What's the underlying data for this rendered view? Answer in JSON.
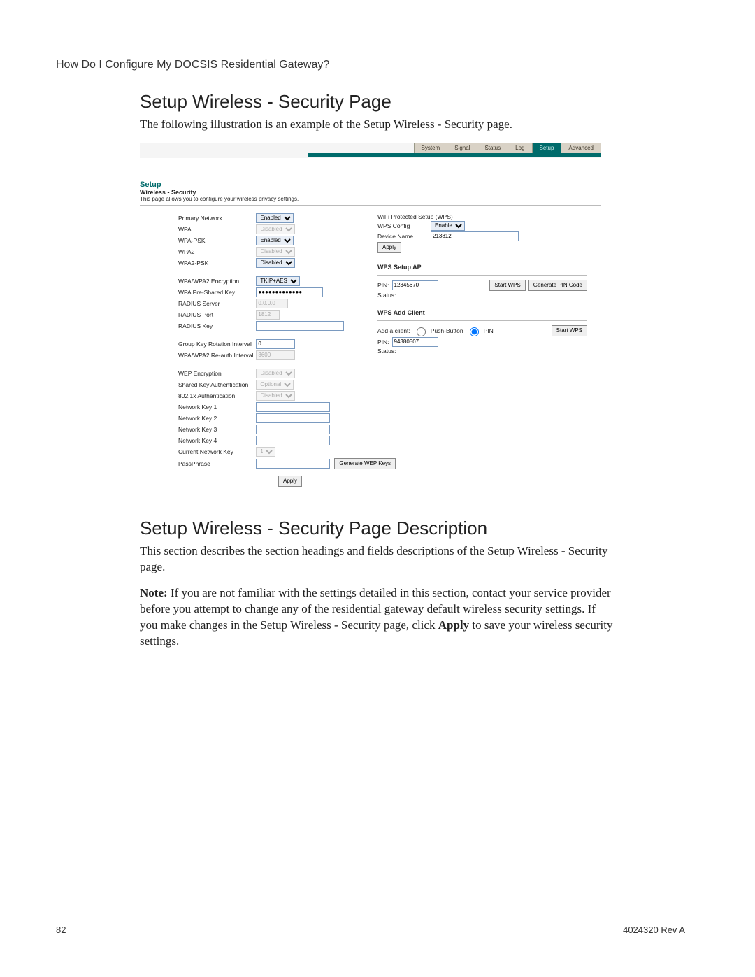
{
  "crumb": "How Do I Configure My DOCSIS Residential Gateway?",
  "section1_title": "Setup Wireless - Security Page",
  "section1_body": "The following illustration is an example of the Setup Wireless - Security page.",
  "section2_title": "Setup Wireless - Security Page Description",
  "section2_body1": "This section describes the section headings and fields descriptions of the Setup Wireless - Security page.",
  "section2_note_strong": "Note:",
  "section2_body2_a": " If you are not familiar with the settings detailed in this section, contact your service provider before you attempt to change any of the residential gateway default wireless security settings. If you make changes in the Setup Wireless - Security page, click ",
  "section2_apply_strong": "Apply",
  "section2_body2_b": " to save your wireless security settings.",
  "footer_left": "82",
  "footer_right": "4024320 Rev A",
  "shot": {
    "tabs": [
      "System",
      "Signal",
      "Status",
      "Log",
      "Setup",
      "Advanced"
    ],
    "active_tab": "Setup",
    "head_h1": "Setup",
    "head_h2": "Wireless - Security",
    "head_sub": "This page allows you to configure your wireless privacy settings.",
    "left": {
      "primary_network": {
        "label": "Primary Network",
        "value": "Enabled"
      },
      "wpa": {
        "label": "WPA",
        "value": "Disabled",
        "disabled": true
      },
      "wpa_psk": {
        "label": "WPA-PSK",
        "value": "Enabled"
      },
      "wpa2": {
        "label": "WPA2",
        "value": "Disabled",
        "disabled": true
      },
      "wpa2_psk": {
        "label": "WPA2-PSK",
        "value": "Disabled"
      },
      "encryption": {
        "label": "WPA/WPA2 Encryption",
        "value": "TKIP+AES"
      },
      "psk": {
        "label": "WPA Pre-Shared Key",
        "value": "●●●●●●●●●●●●●"
      },
      "radius_server": {
        "label": "RADIUS Server",
        "value": "0.0.0.0",
        "disabled": true
      },
      "radius_port": {
        "label": "RADIUS Port",
        "value": "1812",
        "disabled": true
      },
      "radius_key": {
        "label": "RADIUS Key",
        "value": ""
      },
      "gkri": {
        "label": "Group Key Rotation Interval",
        "value": "0"
      },
      "reauth": {
        "label": "WPA/WPA2 Re-auth Interval",
        "value": "3600",
        "disabled": true
      },
      "wep_enc": {
        "label": "WEP Encryption",
        "value": "Disabled",
        "disabled": true
      },
      "shared_auth": {
        "label": "Shared Key Authentication",
        "value": "Optional",
        "disabled": true
      },
      "dot1x": {
        "label": "802.1x Authentication",
        "value": "Disabled",
        "disabled": true
      },
      "nk1": {
        "label": "Network Key 1",
        "value": ""
      },
      "nk2": {
        "label": "Network Key 2",
        "value": ""
      },
      "nk3": {
        "label": "Network Key 3",
        "value": ""
      },
      "nk4": {
        "label": "Network Key 4",
        "value": ""
      },
      "cur_key": {
        "label": "Current Network Key",
        "value": "1",
        "disabled": true
      },
      "passphrase": {
        "label": "PassPhrase",
        "value": ""
      },
      "gen_wep": "Generate WEP Keys",
      "apply": "Apply"
    },
    "right": {
      "wps_title": "WiFi Protected Setup (WPS)",
      "wps_config": {
        "label": "WPS Config",
        "value": "Enable"
      },
      "device_name": {
        "label": "Device Name",
        "value": "213812"
      },
      "apply": "Apply",
      "setup_ap_title": "WPS Setup AP",
      "ap_pin": {
        "label": "PIN:",
        "value": "12345670"
      },
      "start_wps": "Start WPS",
      "gen_pin": "Generate PIN Code",
      "ap_status": {
        "label": "Status:",
        "value": ""
      },
      "add_client_title": "WPS Add Client",
      "add_client_label": "Add a client:",
      "push_button": "Push-Button",
      "pin_radio": "PIN",
      "start_wps2": "Start WPS",
      "client_pin": {
        "label": "PIN:",
        "value": "94380507"
      },
      "client_status": {
        "label": "Status:",
        "value": ""
      }
    }
  }
}
